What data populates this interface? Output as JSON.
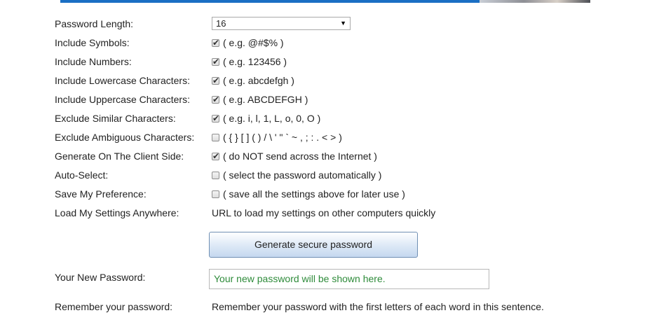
{
  "colors": {
    "accent_bar": "#1a6fc4",
    "password_text": "#2e8b3a"
  },
  "form": {
    "password_length": {
      "label": "Password Length:",
      "value": "16"
    },
    "rows": [
      {
        "name": "include-symbols",
        "label": "Include Symbols:",
        "checked": true,
        "hint": "( e.g. @#$% )"
      },
      {
        "name": "include-numbers",
        "label": "Include Numbers:",
        "checked": true,
        "hint": "( e.g. 123456 )"
      },
      {
        "name": "include-lowercase",
        "label": "Include Lowercase Characters:",
        "checked": true,
        "hint": "( e.g. abcdefgh )"
      },
      {
        "name": "include-uppercase",
        "label": "Include Uppercase Characters:",
        "checked": true,
        "hint": "( e.g. ABCDEFGH )"
      },
      {
        "name": "exclude-similar",
        "label": "Exclude Similar Characters:",
        "checked": true,
        "hint": "( e.g. i, l, 1, L, o, 0, O )"
      },
      {
        "name": "exclude-ambiguous",
        "label": "Exclude Ambiguous Characters:",
        "checked": false,
        "hint": "( { } [ ] ( ) / \\ ' \" ` ~ , ; : . < > )"
      },
      {
        "name": "client-side",
        "label": "Generate On The Client Side:",
        "checked": true,
        "hint": "( do NOT send across the Internet )"
      },
      {
        "name": "auto-select",
        "label": "Auto-Select:",
        "checked": false,
        "hint": "( select the password automatically )"
      },
      {
        "name": "save-preference",
        "label": "Save My Preference:",
        "checked": false,
        "hint": "( save all the settings above for later use )"
      }
    ],
    "load_settings": {
      "label": "Load My Settings Anywhere:",
      "link_text": "URL to load my settings on other computers quickly"
    },
    "generate_button": "Generate secure password",
    "new_password": {
      "label": "Your New Password:",
      "placeholder": "Your new password will be shown here."
    },
    "remember": {
      "label": "Remember your password:",
      "text": "Remember your password with the first letters of each word in this sentence."
    }
  }
}
